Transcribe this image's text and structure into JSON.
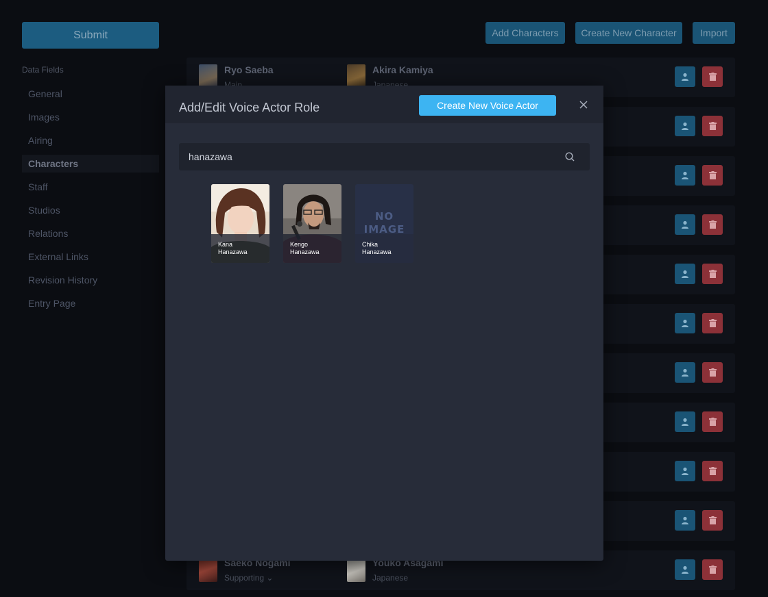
{
  "toolbar": {
    "submit_label": "Submit",
    "add_characters_label": "Add Characters",
    "create_character_label": "Create New Character",
    "import_label": "Import"
  },
  "sidebar": {
    "heading": "Data Fields",
    "items": [
      {
        "label": "General"
      },
      {
        "label": "Images"
      },
      {
        "label": "Airing"
      },
      {
        "label": "Characters",
        "active": true
      },
      {
        "label": "Staff"
      },
      {
        "label": "Studios"
      },
      {
        "label": "Relations"
      },
      {
        "label": "External Links"
      },
      {
        "label": "Revision History"
      },
      {
        "label": "Entry Page"
      }
    ]
  },
  "characters": {
    "rows": [
      {
        "character": "Ryo Saeba",
        "role": "Main",
        "voice_actor": "Akira Kamiya",
        "language": "Japanese"
      },
      {
        "character": "Saeko Nogami",
        "role": "Supporting",
        "voice_actor": "Youko Asagami",
        "language": "Japanese"
      }
    ]
  },
  "modal": {
    "title": "Add/Edit Voice Actor Role",
    "create_button": "Create New Voice Actor",
    "search": {
      "value": "hanazawa"
    },
    "results": [
      {
        "first": "Kana",
        "last": "Hanazawa"
      },
      {
        "first": "Kengo",
        "last": "Hanazawa"
      },
      {
        "first": "Chika",
        "last": "Hanazawa",
        "no_image_line1": "NO",
        "no_image_line2": "IMAGE"
      }
    ]
  },
  "colors": {
    "accent": "#3db4f2",
    "danger": "#8c3138",
    "modal_bg": "#272c39"
  }
}
